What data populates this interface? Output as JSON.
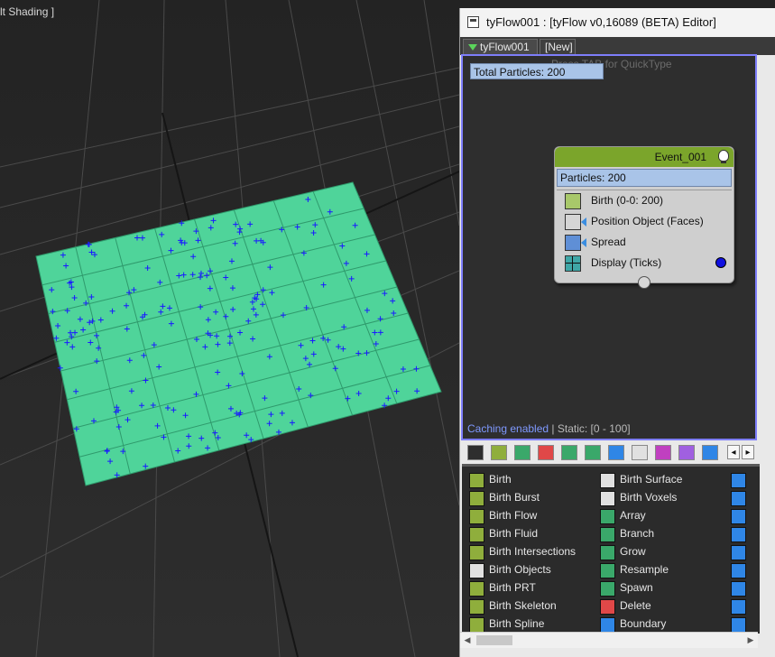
{
  "viewport": {
    "label": "lt Shading ]"
  },
  "editor": {
    "title": "tyFlow001 : [tyFlow v0,16089 (BETA) Editor]",
    "tabs": [
      {
        "label": "tyFlow001"
      },
      {
        "label": "[New]"
      }
    ],
    "hint": "Press TAB for QuickType",
    "total_particles": "Total Particles: 200",
    "caching_on": "Caching enabled",
    "caching_rest": " | Static: [0 - 100]"
  },
  "event": {
    "name": "Event_001",
    "particles": "Particles: 200",
    "operators": [
      {
        "label": "Birth (0-0: 200)",
        "icon": "birth-icon"
      },
      {
        "label": "Position Object (Faces)",
        "icon": "position-object-icon"
      },
      {
        "label": "Spread",
        "icon": "spread-icon"
      },
      {
        "label": "Display (Ticks)",
        "icon": "display-icon"
      }
    ]
  },
  "operator_list": {
    "col1": [
      "Birth",
      "Birth Burst",
      "Birth Flow",
      "Birth Fluid",
      "Birth Intersections",
      "Birth Objects",
      "Birth PRT",
      "Birth Skeleton",
      "Birth Spline"
    ],
    "col2": [
      "Birth Surface",
      "Birth Voxels",
      "Array",
      "Branch",
      "Grow",
      "Resample",
      "Spawn",
      "Delete",
      "Boundary"
    ]
  },
  "colors": {
    "plane": "#4fd49a",
    "particle": "#1a1aff",
    "selection": "#7e7efa",
    "event_header": "#7ba52b"
  }
}
